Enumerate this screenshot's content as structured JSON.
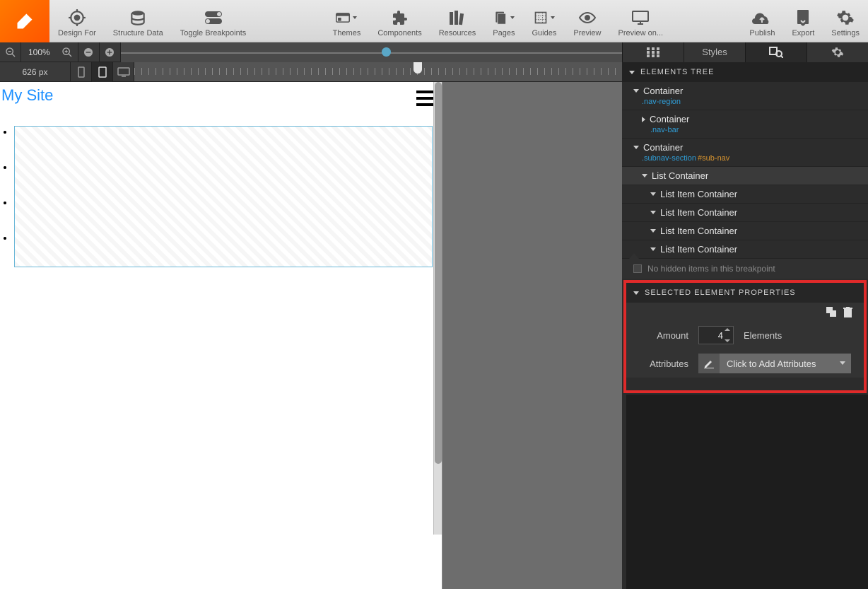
{
  "toolbar": {
    "designFor": "Design For",
    "structureData": "Structure Data",
    "toggleBreakpoints": "Toggle Breakpoints",
    "themes": "Themes",
    "components": "Components",
    "resources": "Resources",
    "pages": "Pages",
    "guides": "Guides",
    "preview": "Preview",
    "previewOn": "Preview on...",
    "publish": "Publish",
    "export": "Export",
    "settings": "Settings"
  },
  "zoom": {
    "level": "100%"
  },
  "breakpoint": {
    "width": "626 px"
  },
  "sideTabs": {
    "styles": "Styles"
  },
  "tree": {
    "title": "Elements Tree",
    "items": [
      {
        "label": "Container",
        "class": ".nav-region",
        "id": ""
      },
      {
        "label": "Container",
        "class": ".nav-bar",
        "id": ""
      },
      {
        "label": "Container",
        "class": ".subnav-section",
        "id": "#sub-nav"
      },
      {
        "label": "List Container",
        "class": "",
        "id": ""
      },
      {
        "label": "List Item Container",
        "class": "",
        "id": ""
      },
      {
        "label": "List Item Container",
        "class": "",
        "id": ""
      },
      {
        "label": "List Item Container",
        "class": "",
        "id": ""
      },
      {
        "label": "List Item Container",
        "class": "",
        "id": ""
      }
    ],
    "hiddenNote": "No hidden items in this breakpoint"
  },
  "props": {
    "title": "Selected Element Properties",
    "amountLabel": "Amount",
    "amountValue": "4",
    "elementsLabel": "Elements",
    "attributesLabel": "Attributes",
    "attrPlaceholder": "Click to Add Attributes"
  },
  "canvas": {
    "siteTitle": "My Site"
  }
}
